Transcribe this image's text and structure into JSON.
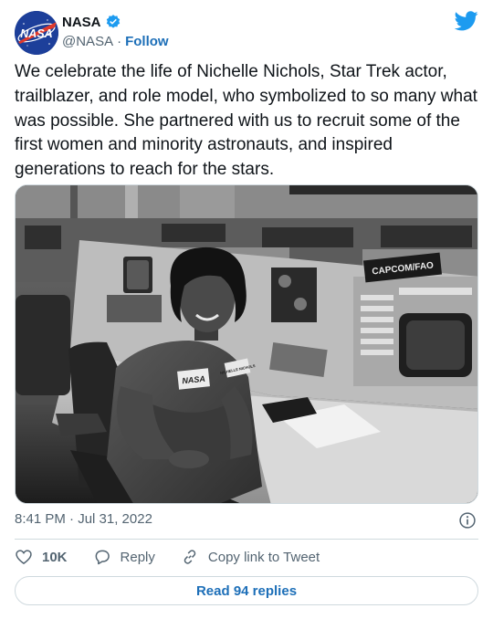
{
  "author": {
    "name": "NASA",
    "handle": "@NASA",
    "separator": "·",
    "follow_label": "Follow",
    "avatar_text": "NASA",
    "verified": true
  },
  "tweet": {
    "text": "We celebrate the life of Nichelle Nichols, Star Trek actor, trailblazer, and role model, who symbolized to so many what was possible. She partnered with us to recruit some of the first women and minority astronauts, and inspired generations to reach for the stars.",
    "timestamp": "8:41 PM · Jul 31, 2022"
  },
  "photo": {
    "sign_text": "CAPCOM/FAO",
    "patch_text": "NASA",
    "name_tag": "NICHELLE NICHOLS",
    "tone": "black-and-white"
  },
  "actions": {
    "like_count": "10K",
    "reply_label": "Reply",
    "copy_label": "Copy link to Tweet"
  },
  "read_replies_label": "Read 94 replies",
  "colors": {
    "text": "#0f1419",
    "muted": "#536471",
    "link": "#1d6fb8",
    "twitter_blue": "#1d9bf0",
    "border": "#cfd9de"
  },
  "icons": {
    "platform": "twitter-bird-icon",
    "verified": "verified-badge-icon",
    "info": "info-icon",
    "like": "heart-icon",
    "reply": "reply-bubble-icon",
    "copy": "link-icon"
  }
}
